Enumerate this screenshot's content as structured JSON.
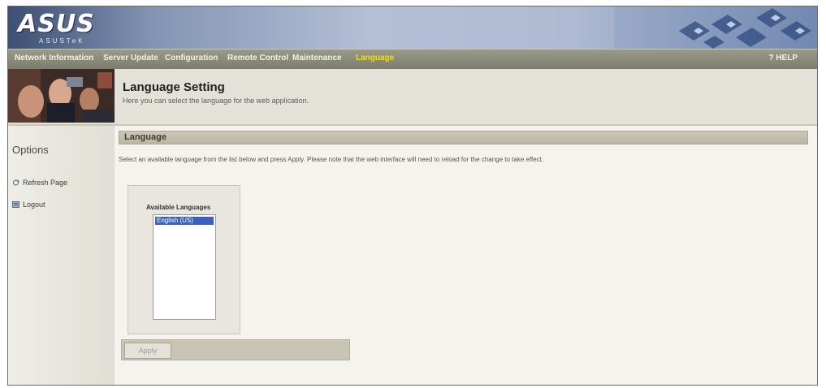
{
  "brand": {
    "logo": "ASUS",
    "tagline": "ASUSTeK"
  },
  "nav": {
    "items": [
      "Network Information",
      "Server Update",
      "Configuration",
      "Remote Control",
      "Maintenance",
      "Language"
    ],
    "active": "Language",
    "help": "? HELP"
  },
  "header": {
    "title": "Language Setting",
    "description": "Here you can select the language for the web application."
  },
  "sidebar": {
    "title": "Options",
    "links": [
      "Refresh Page",
      "Logout"
    ]
  },
  "section": {
    "title": "Language",
    "instructions": "Select an available language from the list below and press Apply. Please note that the web interface will need to reload for the change to take effect."
  },
  "language_select": {
    "label": "Available Languages",
    "selected": "English (US)"
  },
  "apply_button": "Apply",
  "colors": {
    "nav_active": "#f2e200",
    "selection": "#3c5fc4",
    "section_bar": "#bfbca9"
  }
}
